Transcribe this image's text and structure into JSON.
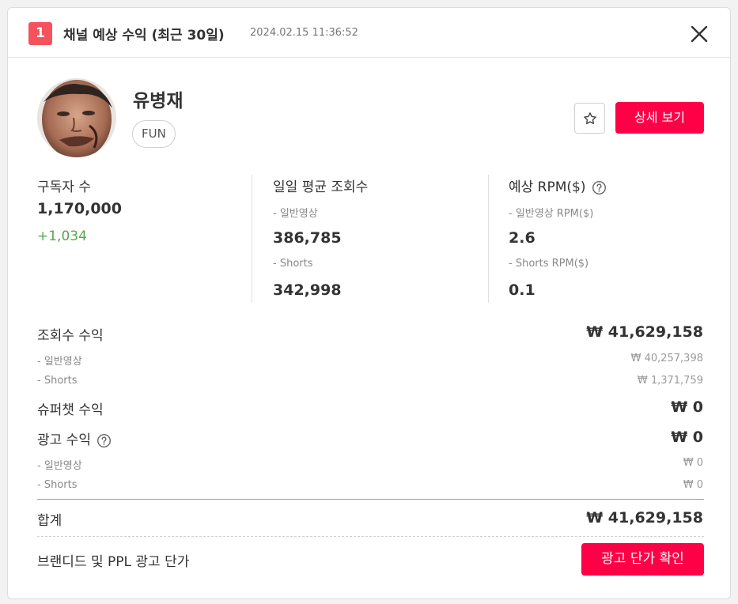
{
  "header": {
    "rank": "1",
    "title": "채널 예상 수익 (최근 30일)",
    "timestamp": "2024.02.15 11:36:52",
    "close_icon": "close-icon"
  },
  "channel": {
    "name": "유병재",
    "category": "FUN",
    "detail_button_label": "상세 보기",
    "star_icon": "star-icon"
  },
  "stats": {
    "subscribers": {
      "label": "구독자 수",
      "value": "1,170,000",
      "change": "+1,034"
    },
    "daily_views": {
      "label": "일일 평균 조회수",
      "normal_label": "- 일반영상",
      "normal_value": "386,785",
      "shorts_label": "- Shorts",
      "shorts_value": "342,998"
    },
    "rpm": {
      "label": "예상 RPM($)",
      "normal_label": "- 일반영상 RPM($)",
      "normal_value": "2.6",
      "shorts_label": "- Shorts RPM($)",
      "shorts_value": "0.1"
    }
  },
  "revenue": {
    "view_revenue": {
      "label": "조회수 수익",
      "value": "₩ 41,629,158",
      "normal_label": "- 일반영상",
      "normal_value": "₩ 40,257,398",
      "shorts_label": "- Shorts",
      "shorts_value": "₩ 1,371,759"
    },
    "superchat": {
      "label": "슈퍼챗 수익",
      "value": "₩ 0"
    },
    "ad_revenue": {
      "label": "광고 수익",
      "value": "₩ 0",
      "normal_label": "- 일반영상",
      "normal_value": "₩ 0",
      "shorts_label": "- Shorts",
      "shorts_value": "₩ 0"
    },
    "total": {
      "label": "합계",
      "value": "₩ 41,629,158"
    }
  },
  "branded": {
    "label": "브랜디드 및 PPL 광고 단가",
    "button_label": "광고 단가 확인"
  },
  "colors": {
    "accent": "#ff0047",
    "rank_badge": "#f4525d",
    "positive": "#52a94e"
  }
}
